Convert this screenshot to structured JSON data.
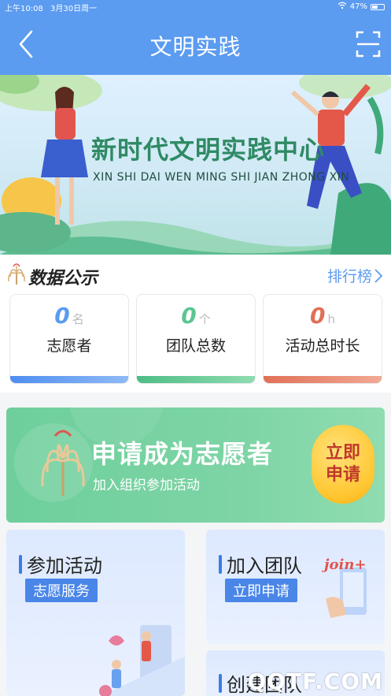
{
  "status_bar": {
    "time": "上午10:08",
    "date": "3月30日周一",
    "battery": "47%",
    "battery_level": 0.47
  },
  "header": {
    "title": "文明实践"
  },
  "banner": {
    "title": "新时代文明实践中心",
    "subtitle": "XIN SHI DAI WEN MING SHI JIAN ZHONG XIN"
  },
  "data_section": {
    "title": "数据公示",
    "rank_link": "排行榜",
    "cards": [
      {
        "value": "0",
        "unit": "名",
        "label": "志愿者",
        "color": "#5b9bf0"
      },
      {
        "value": "0",
        "unit": "个",
        "label": "团队总数",
        "color": "#5cc591"
      },
      {
        "value": "0",
        "unit": "h",
        "label": "活动总时长",
        "color": "#e88870"
      }
    ]
  },
  "apply_banner": {
    "title": "申请成为志愿者",
    "subtitle": "加入组织参加活动",
    "button": "立即\n申请"
  },
  "tiles": {
    "activity": {
      "title": "参加活动",
      "tag": "志愿服务"
    },
    "join_team": {
      "title": "加入团队",
      "tag": "立即申请",
      "art_text": "join+"
    },
    "create_team": {
      "title": "创建团队"
    }
  },
  "watermark": "QQTF.COM",
  "colors": {
    "primary": "#5b9bf0",
    "green": "#6ecf9c",
    "tag_blue": "#4a86e8"
  }
}
